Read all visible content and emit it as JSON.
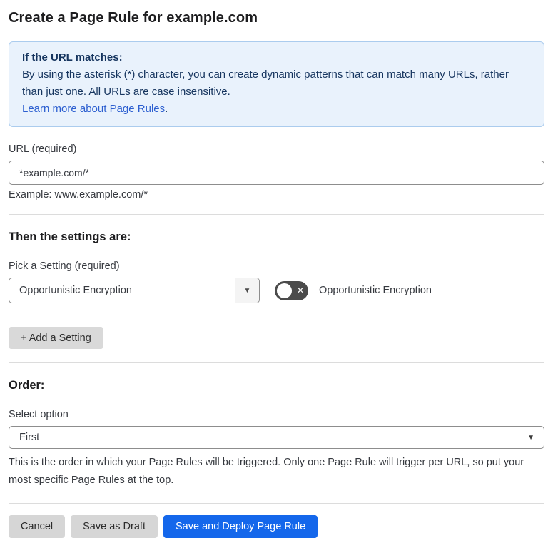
{
  "page": {
    "title": "Create a Page Rule for example.com"
  },
  "info_box": {
    "heading": "If the URL matches:",
    "body": "By using the asterisk (*) character, you can create dynamic patterns that can match many URLs, rather than just one. All URLs are case insensitive.",
    "link_label": "Learn more about Page Rules",
    "link_suffix": "."
  },
  "url_field": {
    "label": "URL (required)",
    "value": "*example.com/*",
    "helper": "Example: www.example.com/*"
  },
  "settings_section": {
    "heading": "Then the settings are:",
    "picker_label": "Pick a Setting (required)",
    "picker_value": "Opportunistic Encryption",
    "toggle_label": "Opportunistic Encryption",
    "toggle_state": "off",
    "add_button_label": "+ Add a Setting"
  },
  "order_section": {
    "heading": "Order:",
    "select_label": "Select option",
    "select_value": "First",
    "helper": "This is the order in which your Page Rules will be triggered. Only one Page Rule will trigger per URL, so put your most specific Page Rules at the top."
  },
  "footer": {
    "cancel_label": "Cancel",
    "save_draft_label": "Save as Draft",
    "save_deploy_label": "Save and Deploy Page Rule"
  },
  "icons": {
    "caret_down": "▼",
    "toggle_x": "✕"
  },
  "colors": {
    "primary_blue": "#1467eb",
    "info_bg": "#e9f2fc",
    "info_border": "#abccee",
    "info_text": "#16355f",
    "link_blue": "#2c5fd0",
    "toggle_off_bg": "#4b4b4b",
    "button_gray": "#d6d6d6"
  }
}
